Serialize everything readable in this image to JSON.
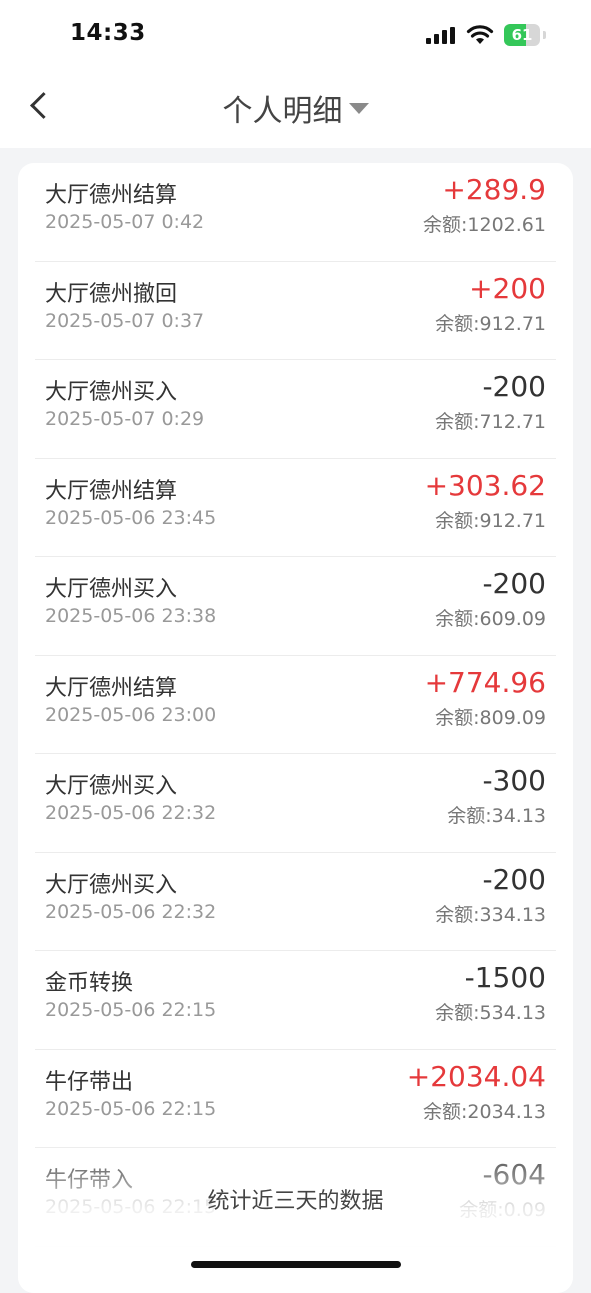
{
  "status_bar": {
    "time": "14:33",
    "battery": "61",
    "battery_percent": 61
  },
  "nav": {
    "title": "个人明细"
  },
  "transactions": [
    {
      "title": "大厅德州结算",
      "time": "2025-05-07 0:42",
      "amount": "+289.9",
      "balance": "余额:1202.61",
      "positive": true
    },
    {
      "title": "大厅德州撤回",
      "time": "2025-05-07 0:37",
      "amount": "+200",
      "balance": "余额:912.71",
      "positive": true
    },
    {
      "title": "大厅德州买入",
      "time": "2025-05-07 0:29",
      "amount": "-200",
      "balance": "余额:712.71",
      "positive": false
    },
    {
      "title": "大厅德州结算",
      "time": "2025-05-06 23:45",
      "amount": "+303.62",
      "balance": "余额:912.71",
      "positive": true
    },
    {
      "title": "大厅德州买入",
      "time": "2025-05-06 23:38",
      "amount": "-200",
      "balance": "余额:609.09",
      "positive": false
    },
    {
      "title": "大厅德州结算",
      "time": "2025-05-06 23:00",
      "amount": "+774.96",
      "balance": "余额:809.09",
      "positive": true
    },
    {
      "title": "大厅德州买入",
      "time": "2025-05-06 22:32",
      "amount": "-300",
      "balance": "余额:34.13",
      "positive": false
    },
    {
      "title": "大厅德州买入",
      "time": "2025-05-06 22:32",
      "amount": "-200",
      "balance": "余额:334.13",
      "positive": false
    },
    {
      "title": "金币转换",
      "time": "2025-05-06 22:15",
      "amount": "-1500",
      "balance": "余额:534.13",
      "positive": false
    },
    {
      "title": "牛仔带出",
      "time": "2025-05-06 22:15",
      "amount": "+2034.04",
      "balance": "余额:2034.13",
      "positive": true
    },
    {
      "title": "牛仔带入",
      "time": "2025-05-06 22:15",
      "amount": "-604",
      "balance": "余额:0.09",
      "positive": false
    }
  ],
  "footer": {
    "note": "统计近三天的数据"
  },
  "colors": {
    "positive": "#e5393b",
    "neutral": "#333333",
    "battery": "#34c759"
  }
}
